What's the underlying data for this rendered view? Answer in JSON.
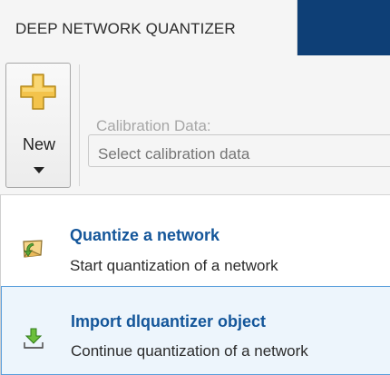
{
  "tab": {
    "label": "DEEP NETWORK QUANTIZER"
  },
  "toolstrip": {
    "new_button": {
      "label": "New",
      "icon": "plus-icon"
    },
    "calibration": {
      "label": "Calibration Data:",
      "placeholder": "Select calibration data"
    }
  },
  "menu": {
    "items": [
      {
        "title": "Quantize a network",
        "description": "Start quantization of a network",
        "icon": "quantize-network-icon"
      },
      {
        "title": "Import dlquantizer object",
        "description": "Continue quantization of a network",
        "icon": "import-icon"
      }
    ]
  },
  "colors": {
    "tab_strip": "#0e3f76",
    "accent_title": "#14569a",
    "hover_background": "#edf5fc",
    "hover_border": "#5a9fdc",
    "plus_icon": "#f3c34b"
  }
}
